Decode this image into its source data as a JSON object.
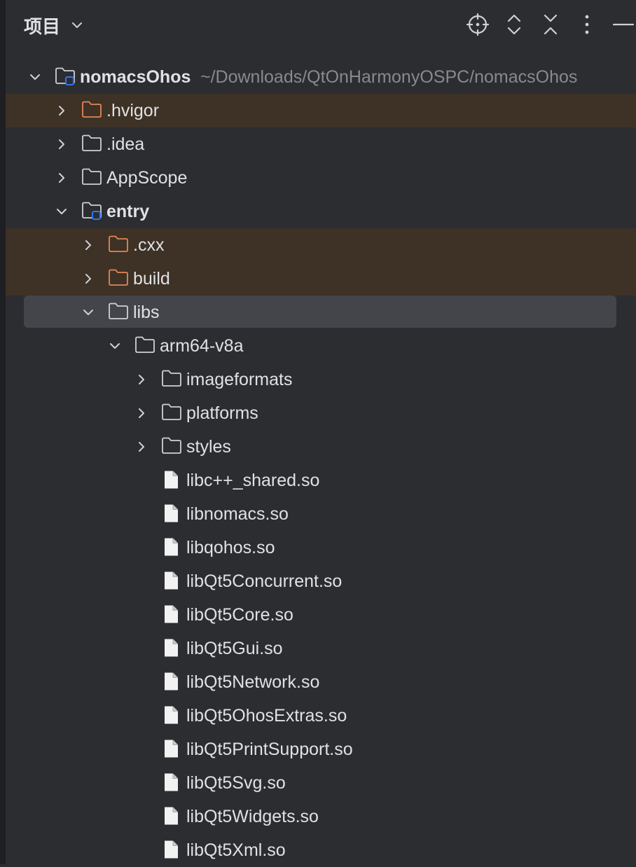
{
  "panel": {
    "title": "项目"
  },
  "colors": {
    "background": "#2b2d30",
    "excluded_row": "#3e3126",
    "selected_row": "#43454a",
    "excluded_folder": "#e08855",
    "module_badge": "#3574f0"
  },
  "toolbar": {
    "icons": [
      "locate-icon",
      "expand-all-icon",
      "collapse-all-icon",
      "more-icon",
      "minimize-icon"
    ]
  },
  "tree": {
    "project": {
      "name": "nomacsOhos",
      "path": "~/Downloads/QtOnHarmonyOSPC/nomacsOhos"
    },
    "items": [
      {
        "label": ".hvigor",
        "depth": 1,
        "kind": "folder",
        "expanded": false,
        "excluded": true
      },
      {
        "label": ".idea",
        "depth": 1,
        "kind": "folder",
        "expanded": false
      },
      {
        "label": "AppScope",
        "depth": 1,
        "kind": "folder",
        "expanded": false
      },
      {
        "label": "entry",
        "depth": 1,
        "kind": "module",
        "expanded": true,
        "bold": true
      },
      {
        "label": ".cxx",
        "depth": 2,
        "kind": "folder",
        "expanded": false,
        "excluded": true
      },
      {
        "label": "build",
        "depth": 2,
        "kind": "folder",
        "expanded": false,
        "excluded": true
      },
      {
        "label": "libs",
        "depth": 2,
        "kind": "folder",
        "expanded": true,
        "selected": true
      },
      {
        "label": "arm64-v8a",
        "depth": 3,
        "kind": "folder",
        "expanded": true
      },
      {
        "label": "imageformats",
        "depth": 4,
        "kind": "folder",
        "expanded": false
      },
      {
        "label": "platforms",
        "depth": 4,
        "kind": "folder",
        "expanded": false
      },
      {
        "label": "styles",
        "depth": 4,
        "kind": "folder",
        "expanded": false
      },
      {
        "label": "libc++_shared.so",
        "depth": 4,
        "kind": "file"
      },
      {
        "label": "libnomacs.so",
        "depth": 4,
        "kind": "file"
      },
      {
        "label": "libqohos.so",
        "depth": 4,
        "kind": "file"
      },
      {
        "label": "libQt5Concurrent.so",
        "depth": 4,
        "kind": "file"
      },
      {
        "label": "libQt5Core.so",
        "depth": 4,
        "kind": "file"
      },
      {
        "label": "libQt5Gui.so",
        "depth": 4,
        "kind": "file"
      },
      {
        "label": "libQt5Network.so",
        "depth": 4,
        "kind": "file"
      },
      {
        "label": "libQt5OhosExtras.so",
        "depth": 4,
        "kind": "file"
      },
      {
        "label": "libQt5PrintSupport.so",
        "depth": 4,
        "kind": "file"
      },
      {
        "label": "libQt5Svg.so",
        "depth": 4,
        "kind": "file"
      },
      {
        "label": "libQt5Widgets.so",
        "depth": 4,
        "kind": "file"
      },
      {
        "label": "libQt5Xml.so",
        "depth": 4,
        "kind": "file"
      }
    ]
  }
}
